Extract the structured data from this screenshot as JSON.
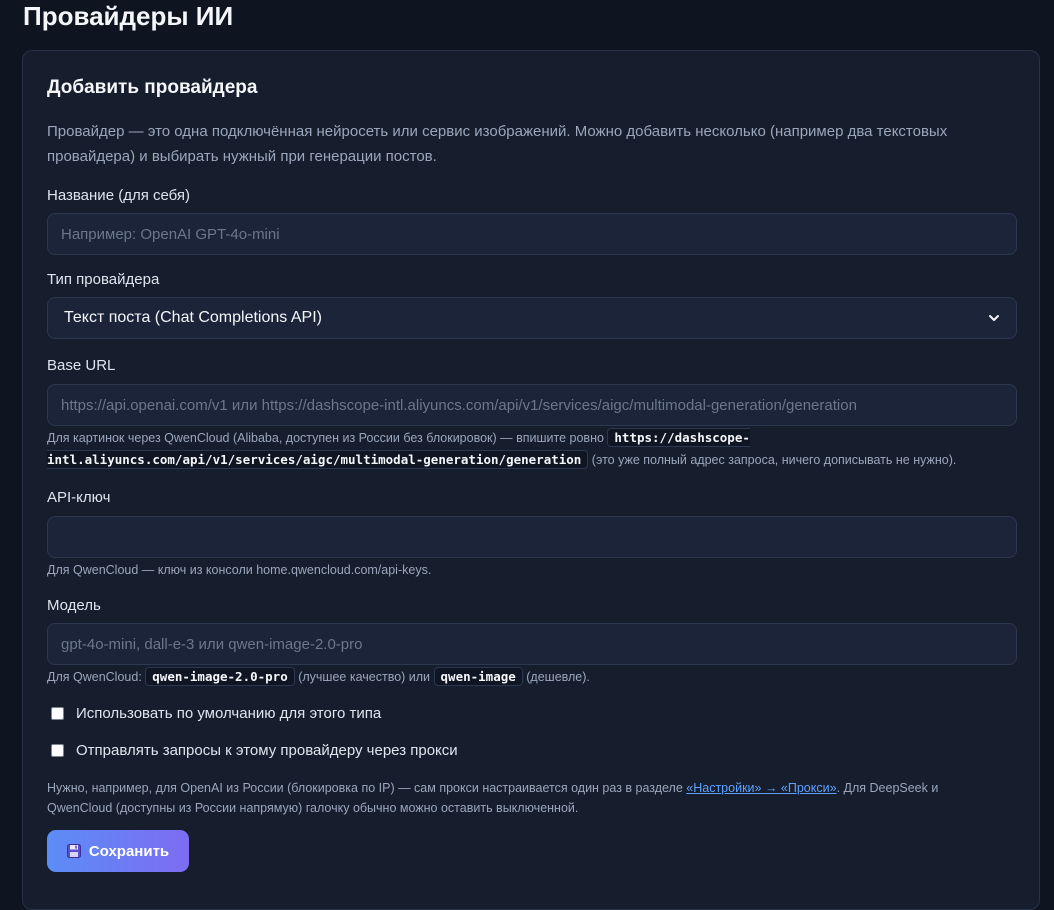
{
  "page": {
    "title": "Провайдеры ИИ"
  },
  "card": {
    "title": "Добавить провайдера",
    "intro": "Провайдер — это одна подключённая нейросеть или сервис изображений. Можно добавить несколько (например два текстовых провайдера) и выбирать нужный при генерации постов."
  },
  "fields": {
    "name": {
      "label": "Название (для себя)",
      "placeholder": "Например: OpenAI GPT-4o-mini",
      "value": ""
    },
    "type": {
      "label": "Тип провайдера",
      "selected": "Текст поста (Chat Completions API)"
    },
    "base_url": {
      "label": "Base URL",
      "placeholder": "https://api.openai.com/v1 или https://dashscope-intl.aliyuncs.com/api/v1/services/aigc/multimodal-generation/generation",
      "value": "",
      "hint_prefix": "Для картинок через QwenCloud (Alibaba, доступен из России без блокировок) — впишите ровно ",
      "hint_code": "https://dashscope-intl.aliyuncs.com/api/v1/services/aigc/multimodal-generation/generation",
      "hint_suffix": " (это уже полный адрес запроса, ничего дописывать не нужно)."
    },
    "api_key": {
      "label": "API-ключ",
      "placeholder": "",
      "value": "",
      "hint": "Для QwenCloud — ключ из консоли home.qwencloud.com/api-keys."
    },
    "model": {
      "label": "Модель",
      "placeholder": "gpt-4o-mini, dall-e-3 или qwen-image-2.0-pro",
      "value": "",
      "hint_prefix": "Для QwenCloud: ",
      "hint_code1": "qwen-image-2.0-pro",
      "hint_middle": " (лучшее качество) или ",
      "hint_code2": "qwen-image",
      "hint_suffix": " (дешевле)."
    }
  },
  "checkboxes": {
    "default": {
      "label": "Использовать по умолчанию для этого типа",
      "checked": false
    },
    "proxy": {
      "label": "Отправлять запросы к этому провайдеру через прокси",
      "checked": false
    }
  },
  "note": {
    "prefix": "Нужно, например, для OpenAI из России (блокировка по IP) — сам прокси настраивается один раз в разделе ",
    "link": "«Настройки» → «Прокси»",
    "suffix": ". Для DeepSeek и QwenCloud (доступны из России напрямую) галочку обычно можно оставить выключенной."
  },
  "actions": {
    "save_icon": "floppy-disk-icon",
    "save_label": "Сохранить"
  },
  "colors": {
    "accent_start": "#5b8df6",
    "accent_end": "#7d6cf2",
    "link": "#5ea2ff"
  }
}
